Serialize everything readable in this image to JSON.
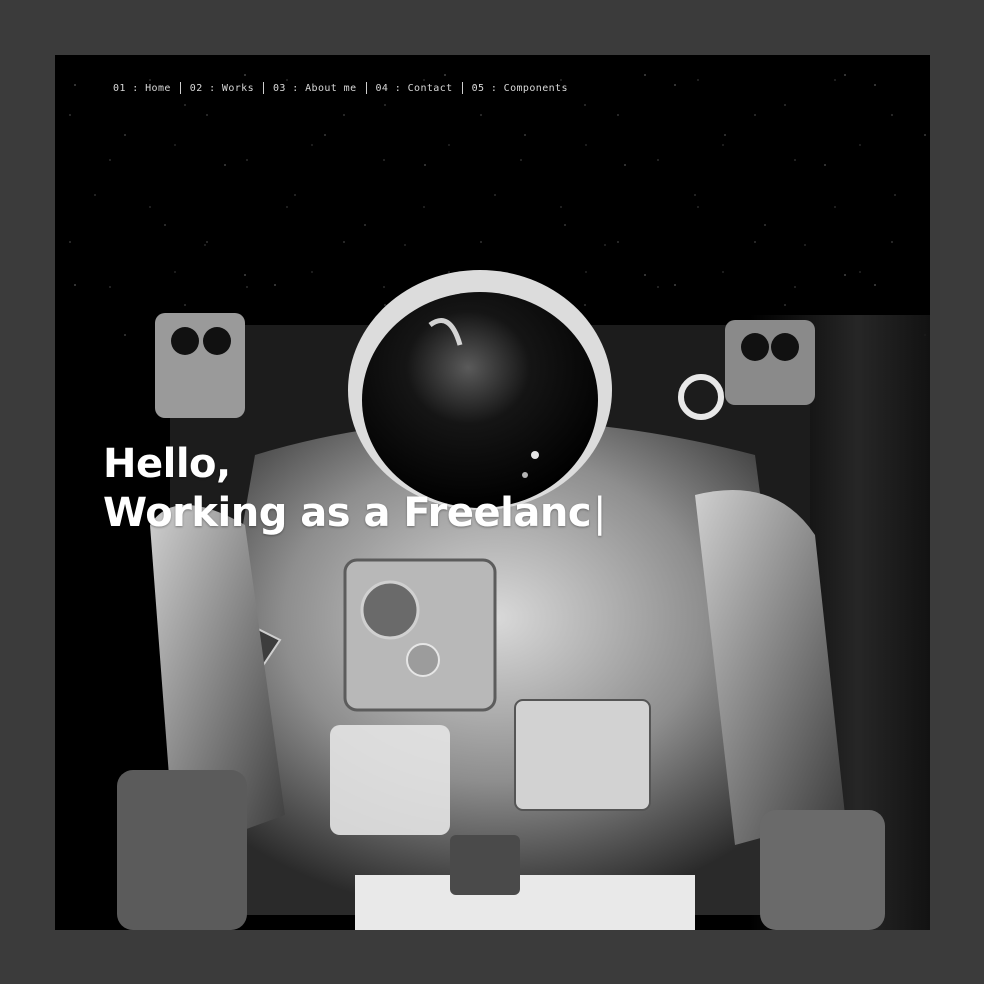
{
  "nav": {
    "items": [
      {
        "number": "01",
        "separator": ":",
        "label": "Home"
      },
      {
        "number": "02",
        "separator": ":",
        "label": "Works"
      },
      {
        "number": "03",
        "separator": ":",
        "label": "About me"
      },
      {
        "number": "04",
        "separator": ":",
        "label": "Contact"
      },
      {
        "number": "05",
        "separator": ":",
        "label": "Components"
      }
    ]
  },
  "hero": {
    "greeting": "Hello,",
    "typed_text": "Working as a Freelanc",
    "cursor": "|"
  },
  "colors": {
    "page_background": "#3b3b3b",
    "frame_background": "#000000",
    "text": "#ffffff"
  },
  "icons": {
    "hero_image": "astronaut-photo"
  }
}
